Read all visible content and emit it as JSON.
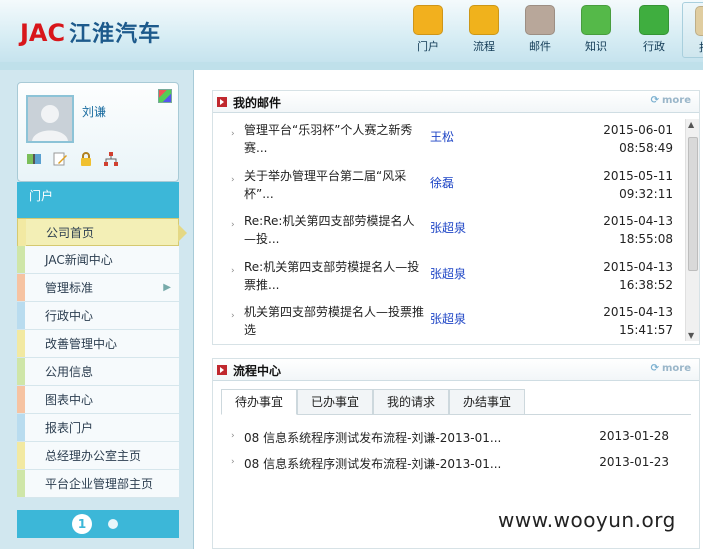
{
  "header": {
    "logo_latin": "JAC",
    "logo_cn": "江淮汽车",
    "nav": [
      {
        "label": "门户",
        "icon": "home-icon",
        "color": "#f2b01e"
      },
      {
        "label": "流程",
        "icon": "bar-chart-icon",
        "color": "#f0b21c"
      },
      {
        "label": "邮件",
        "icon": "envelope-icon",
        "color": "#b8a79a"
      },
      {
        "label": "知识",
        "icon": "server-icon",
        "color": "#55b949"
      },
      {
        "label": "行政",
        "icon": "infinity-icon",
        "color": "#3fae3f"
      },
      {
        "label": "报表",
        "icon": "report-icon",
        "color": "#e0cda0"
      }
    ]
  },
  "profile": {
    "name": "刘谦"
  },
  "menu": {
    "header": "门户",
    "items": [
      {
        "label": "公司首页",
        "bar": "#f2e9a2",
        "active": true
      },
      {
        "label": "JAC新闻中心",
        "bar": "#cfe6a8"
      },
      {
        "label": "管理标准",
        "bar": "#f6c3a2",
        "has_arrow": true
      },
      {
        "label": "行政中心",
        "bar": "#b9dcef"
      },
      {
        "label": "改善管理中心",
        "bar": "#f2e9a2"
      },
      {
        "label": "公用信息",
        "bar": "#cfe6a8"
      },
      {
        "label": "图表中心",
        "bar": "#f6c3a2"
      },
      {
        "label": "报表门户",
        "bar": "#b9dcef"
      },
      {
        "label": "总经理办公室主页",
        "bar": "#f2e9a2"
      },
      {
        "label": "平台企业管理部主页",
        "bar": "#cfe6a8"
      }
    ],
    "pager": {
      "current": "1"
    }
  },
  "mail": {
    "title": "我的邮件",
    "more": "more",
    "rows": [
      {
        "subject": "管理平台“乐羽杯”个人赛之新秀赛...",
        "sender": "王松",
        "date": "2015-06-01",
        "time": "08:58:49"
      },
      {
        "subject": "关于举办管理平台第二届“风采杯”...",
        "sender": "徐磊",
        "date": "2015-05-11",
        "time": "09:32:11"
      },
      {
        "subject": "Re:Re:机关第四支部劳模提名人—投...",
        "sender": "张超泉",
        "date": "2015-04-13",
        "time": "18:55:08"
      },
      {
        "subject": "Re:机关第四支部劳模提名人—投票推...",
        "sender": "张超泉",
        "date": "2015-04-13",
        "time": "16:38:52"
      },
      {
        "subject": "机关第四支部劳模提名人—投票推选",
        "sender": "张超泉",
        "date": "2015-04-13",
        "time": "15:41:57"
      }
    ]
  },
  "flow": {
    "title": "流程中心",
    "more": "more",
    "tabs": [
      "待办事宜",
      "已办事宜",
      "我的请求",
      "办结事宜"
    ],
    "rows": [
      {
        "title": "08 信息系统程序测试发布流程-刘谦-2013-01...",
        "date": "2013-01-28"
      },
      {
        "title": "08 信息系统程序测试发布流程-刘谦-2013-01...",
        "date": "2013-01-23"
      }
    ]
  },
  "watermark": "www.wooyun.org"
}
